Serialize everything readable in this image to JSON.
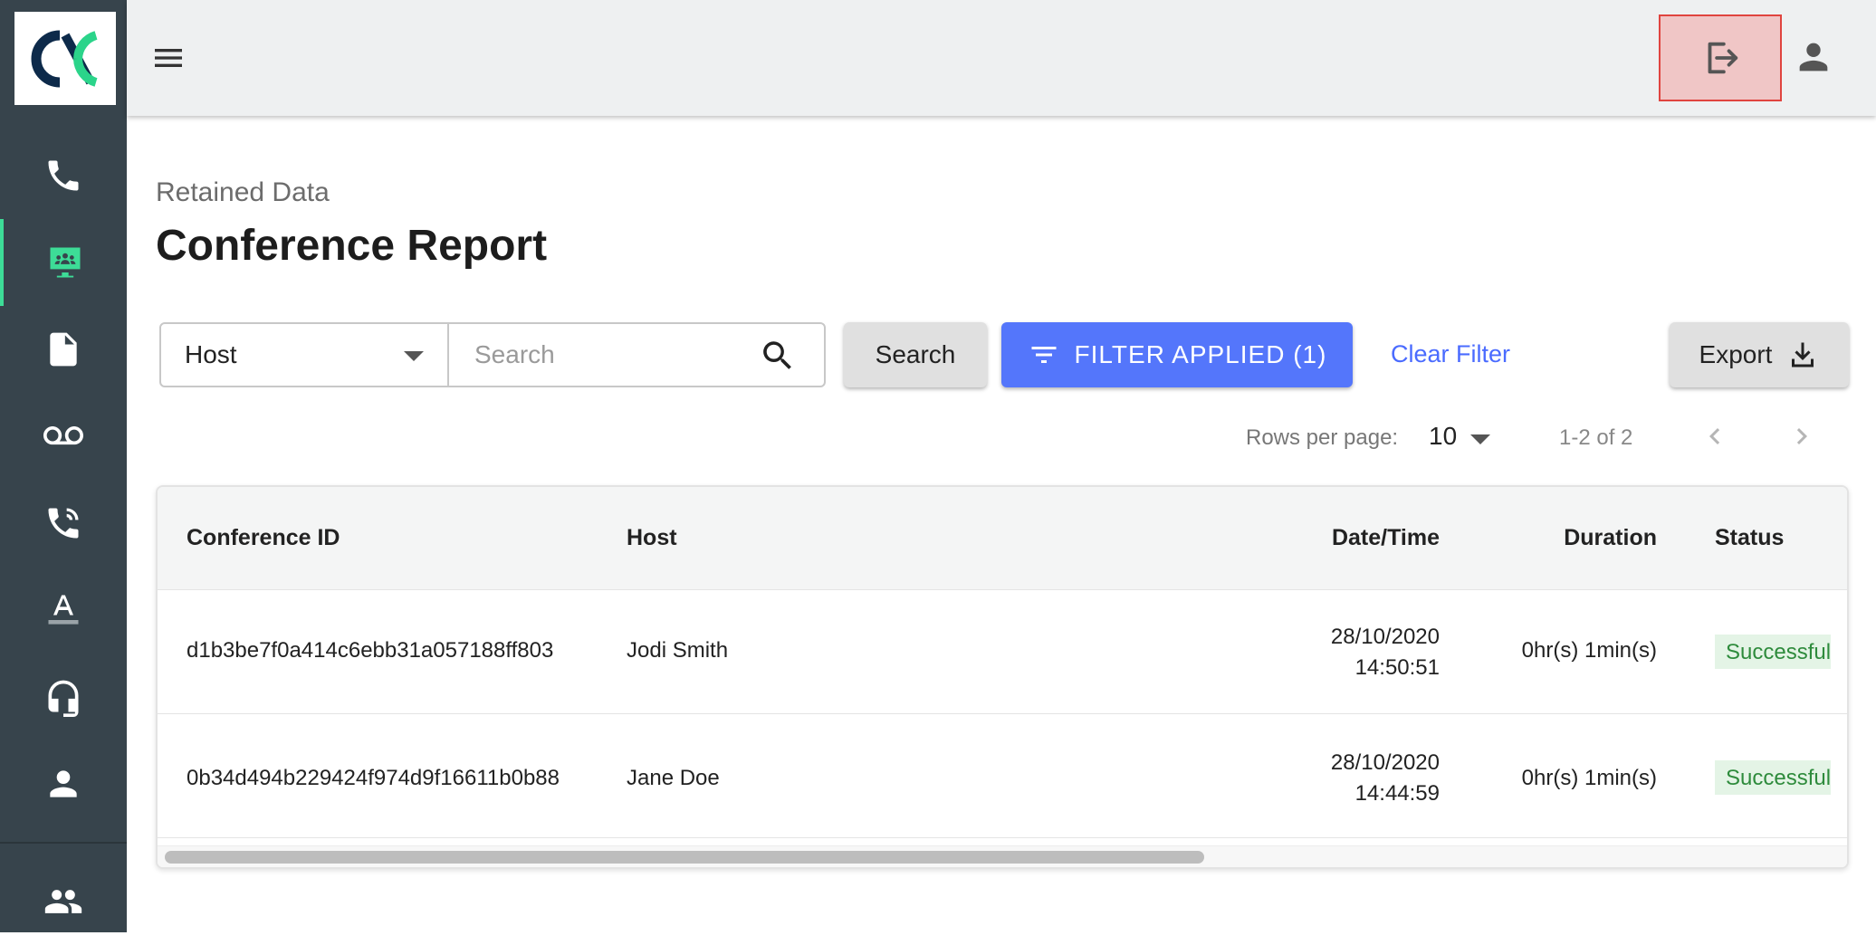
{
  "app": {
    "logo_text": "CX",
    "accent_color": "#3ddc97",
    "sidebar_color": "#37444c"
  },
  "sidebar": {
    "items": [
      {
        "name": "phone-icon",
        "active": false
      },
      {
        "name": "conference-icon",
        "active": true
      },
      {
        "name": "document-icon",
        "active": false
      },
      {
        "name": "voicemail-icon",
        "active": false
      },
      {
        "name": "phone-forward-icon",
        "active": false
      },
      {
        "name": "text-format-icon",
        "active": false
      },
      {
        "name": "headset-icon",
        "active": false
      },
      {
        "name": "person-icon",
        "active": false
      },
      {
        "name": "group-icon",
        "active": false
      }
    ]
  },
  "topbar": {
    "menu_icon": "hamburger-icon",
    "logout_icon": "logout-icon",
    "user_icon": "account-icon"
  },
  "page": {
    "subtitle": "Retained Data",
    "title": "Conference Report"
  },
  "search": {
    "field_value": "Host",
    "placeholder": "Search",
    "search_button": "Search",
    "filter_button": "FILTER APPLIED (1)",
    "clear_filter": "Clear Filter",
    "export_button": "Export"
  },
  "pagination": {
    "rows_label": "Rows per page:",
    "rows_value": "10",
    "range": "1-2 of 2"
  },
  "table": {
    "columns": [
      "Conference ID",
      "Host",
      "Date/Time",
      "Duration",
      "Status"
    ],
    "rows": [
      {
        "id": "d1b3be7f0a414c6ebb31a057188ff803",
        "host": "Jodi Smith",
        "date": "28/10/2020",
        "time": "14:50:51",
        "duration": "0hr(s) 1min(s)",
        "status": "Successful"
      },
      {
        "id": "0b34d494b229424f974d9f16611b0b88",
        "host": "Jane Doe",
        "date": "28/10/2020",
        "time": "14:44:59",
        "duration": "0hr(s) 1min(s)",
        "status": "Successful"
      }
    ]
  }
}
